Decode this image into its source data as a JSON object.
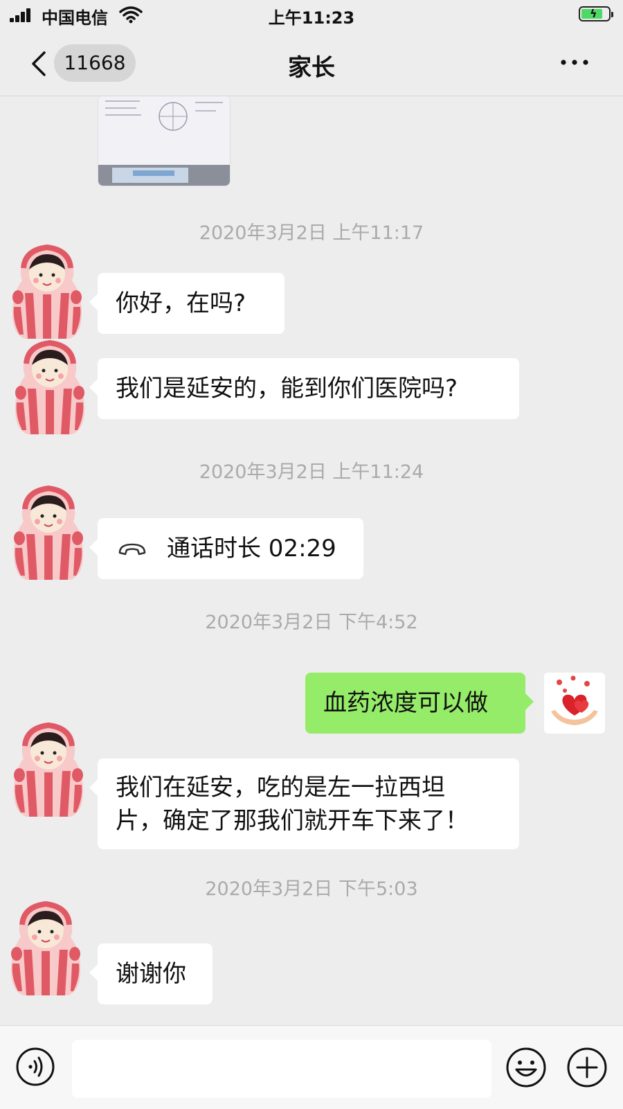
{
  "status_bar": {
    "carrier": "中国电信",
    "time": "上午11:23"
  },
  "nav": {
    "back_badge": "11668",
    "title": "家长"
  },
  "messages": [
    {
      "type": "timestamp",
      "text": "2020年3月2日 上午11:17"
    },
    {
      "type": "text",
      "sender": "other",
      "text": "你好，在吗?"
    },
    {
      "type": "text",
      "sender": "other",
      "text": "我们是延安的，能到你们医院吗?"
    },
    {
      "type": "timestamp",
      "text": "2020年3月2日 上午11:24"
    },
    {
      "type": "call",
      "sender": "other",
      "text": "通话时长 02:29"
    },
    {
      "type": "timestamp",
      "text": "2020年3月2日 下午4:52"
    },
    {
      "type": "text",
      "sender": "me",
      "text": "血药浓度可以做"
    },
    {
      "type": "text",
      "sender": "other",
      "lines": [
        "我们在延安，吃的是左一拉西坦",
        "片，确定了那我们就开车下来了！"
      ]
    },
    {
      "type": "timestamp",
      "text": "2020年3月2日 下午5:03"
    },
    {
      "type": "text",
      "sender": "other",
      "text": "谢谢你"
    }
  ],
  "colors": {
    "my_bubble": "#95ec69",
    "other_bubble": "#ffffff",
    "background": "#ededed",
    "timestamp_text": "#aaaaaa"
  },
  "icons": [
    "back-icon",
    "more-icon",
    "call-icon",
    "voice-icon",
    "emoji-icon",
    "plus-icon"
  ]
}
